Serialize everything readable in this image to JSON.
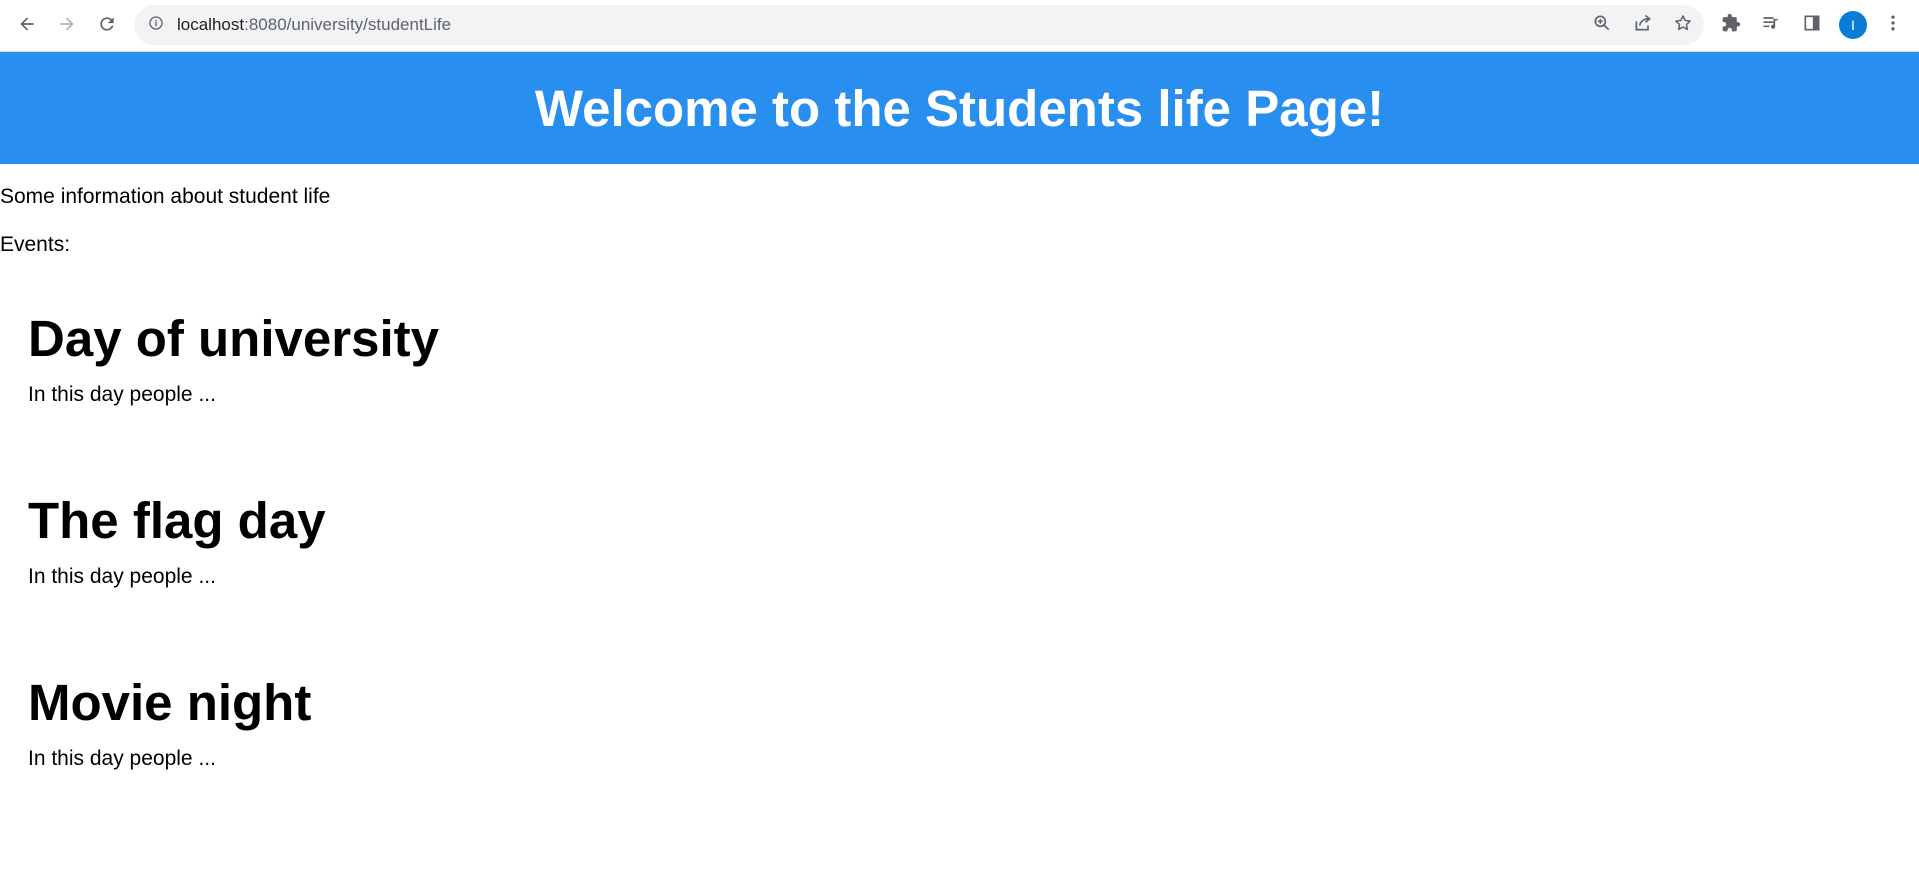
{
  "browser": {
    "url_host": "localhost",
    "url_rest": ":8080/university/studentLife",
    "profile_initial": "I"
  },
  "page": {
    "banner_title": "Welcome to the Students life Page!",
    "intro": "Some information about student life",
    "events_label": "Events:",
    "events": [
      {
        "title": "Day of university",
        "description": "In this day people ..."
      },
      {
        "title": "The flag day",
        "description": "In this day people ..."
      },
      {
        "title": "Movie night",
        "description": "In this day people ..."
      }
    ]
  },
  "colors": {
    "banner": "#288ef0",
    "avatar": "#0b7cd6"
  },
  "icons": {
    "back": "arrow-left-icon",
    "forward": "arrow-right-icon",
    "reload": "reload-icon",
    "site_info": "info-icon",
    "zoom": "zoom-icon",
    "share": "share-icon",
    "bookmark": "star-icon",
    "extensions": "puzzle-icon",
    "media": "media-queue-icon",
    "side_panel": "side-panel-icon",
    "menu": "kebab-menu-icon"
  }
}
